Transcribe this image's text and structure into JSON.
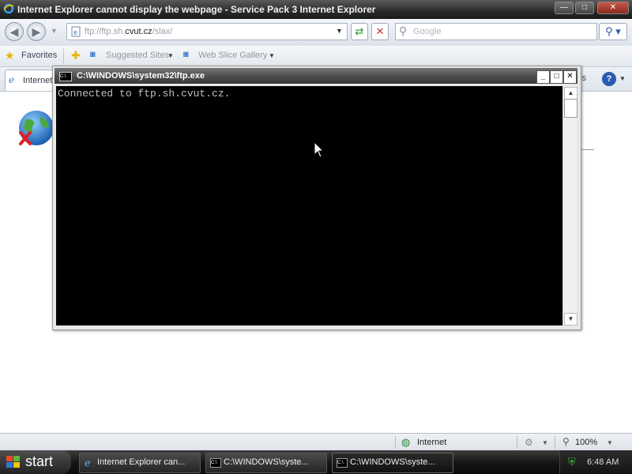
{
  "browser": {
    "title": "Internet Explorer cannot display the webpage - Service Pack 3 Internet Explorer",
    "address_host": "ftp://ftp.sh.",
    "address_domain": "cvut.cz",
    "address_path": "/slax/",
    "search_placeholder": "Google",
    "favorites_label": "Favorites",
    "suggested_sites_label": "Suggested Sites",
    "web_slice_label": "Web Slice Gallery",
    "tab_label": "Internet",
    "tools_partial": "ls",
    "status_zone": "Internet",
    "zoom": "100%"
  },
  "cmd": {
    "title": "C:\\WINDOWS\\system32\\ftp.exe",
    "output": "Connected to ftp.sh.cvut.cz."
  },
  "taskbar": {
    "start_label": "start",
    "tasks": [
      "Internet Explorer can...",
      "C:\\WINDOWS\\syste...",
      "C:\\WINDOWS\\syste..."
    ],
    "clock": "6:48 AM"
  }
}
